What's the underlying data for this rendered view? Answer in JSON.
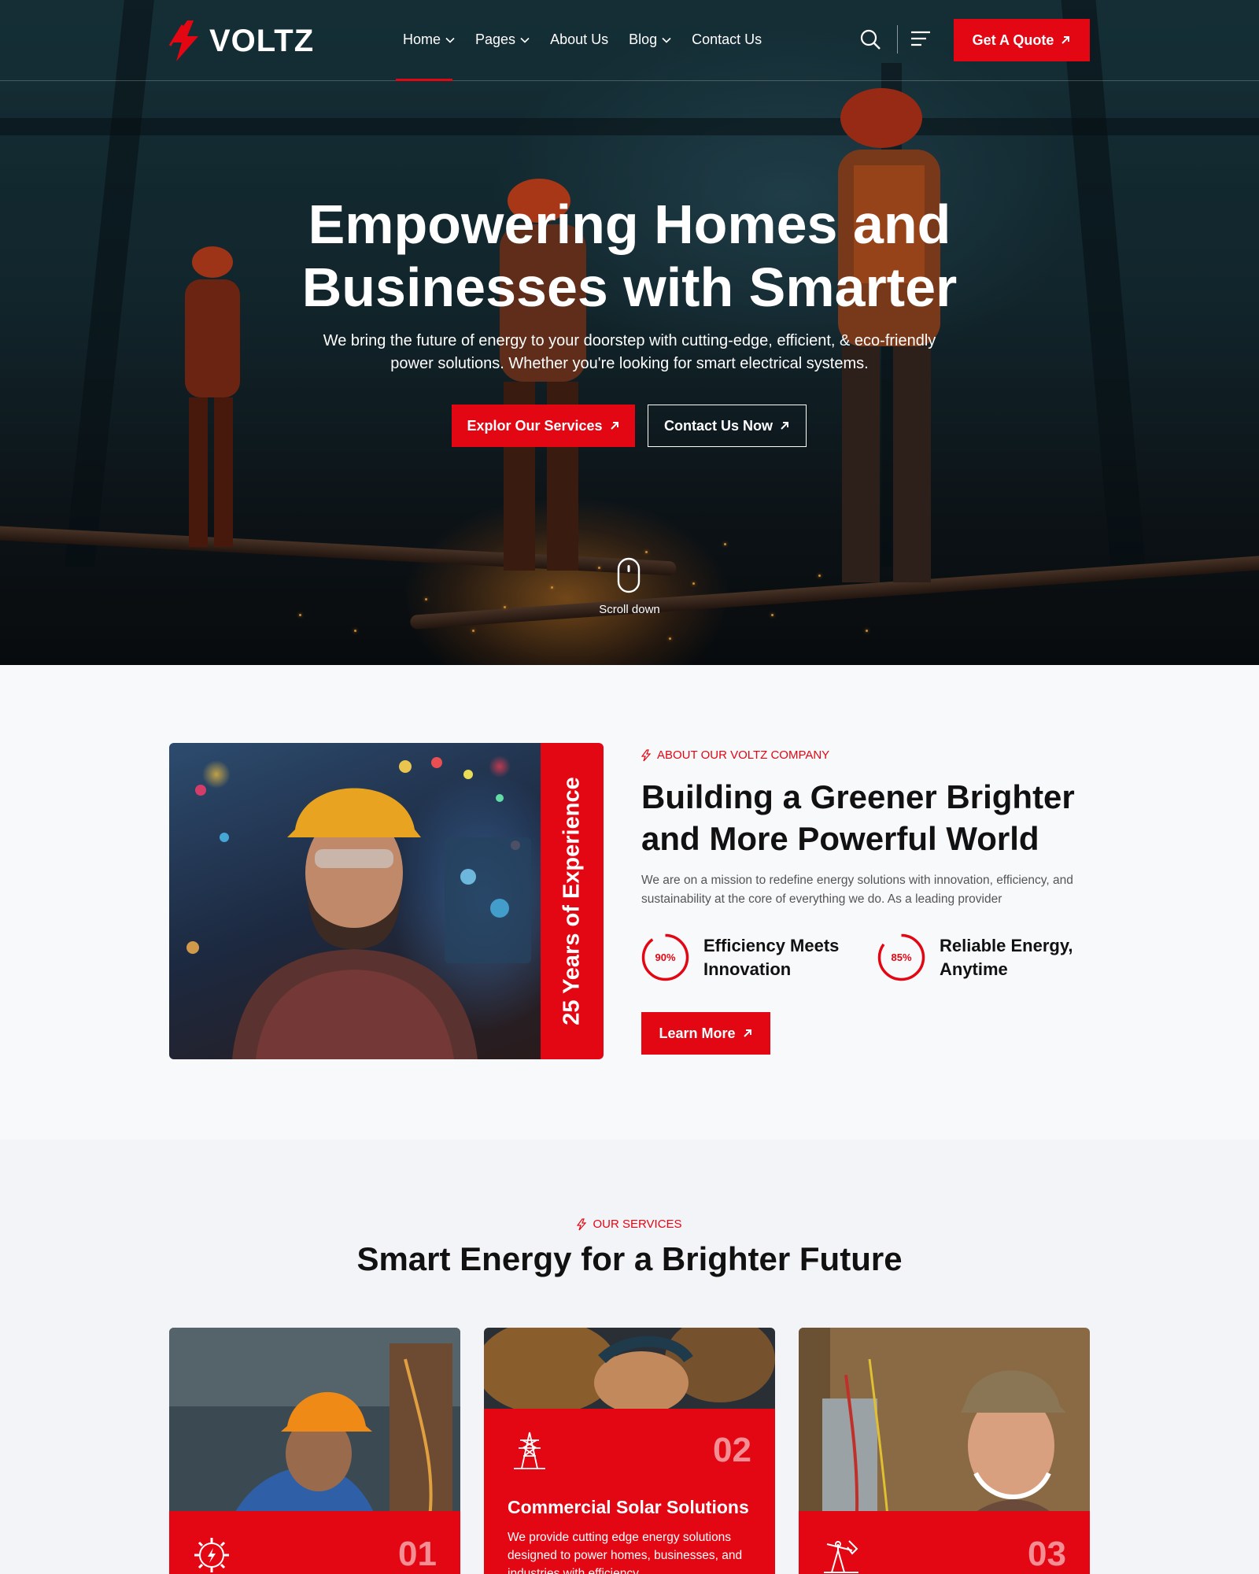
{
  "nav": {
    "logo": "VOLTZ",
    "items": [
      {
        "label": "Home",
        "dropdown": true,
        "active": true
      },
      {
        "label": "Pages",
        "dropdown": true
      },
      {
        "label": "About Us",
        "dropdown": false
      },
      {
        "label": "Blog",
        "dropdown": true
      },
      {
        "label": "Contact Us",
        "dropdown": false
      }
    ],
    "quote_label": "Get A Quote"
  },
  "hero": {
    "title": "Empowering Homes and Businesses with Smarter",
    "subtitle": "We bring the future of energy to your doorstep with cutting-edge, efficient, & eco-friendly power solutions. Whether you're looking for smart electrical systems.",
    "primary_cta": "Explor Our Services",
    "secondary_cta": "Contact Us Now",
    "scroll_label": "Scroll down"
  },
  "about": {
    "experience_band": "25 Years of Experience",
    "eyebrow": "ABOUT OUR VOLTZ COMPANY",
    "title": "Building a Greener Brighter and More Powerful World",
    "description": "We are on a mission to redefine energy solutions with innovation, efficiency, and sustainability at the core of everything we do. As a leading provider",
    "stats": [
      {
        "percent": 90,
        "value_label": "90%",
        "label": "Efficiency Meets Innovation"
      },
      {
        "percent": 85,
        "value_label": "85%",
        "label": "Reliable Energy, Anytime"
      }
    ],
    "cta": "Learn More"
  },
  "services": {
    "eyebrow": "OUR SERVICES",
    "title": "Smart Energy for a Brighter Future",
    "cards": [
      {
        "number": "01",
        "icon": "gear-bolt-icon"
      },
      {
        "number": "02",
        "icon": "transmission-tower-icon",
        "title": "Commercial Solar Solutions",
        "text": "We provide cutting edge energy solutions designed to power homes, businesses, and industries with efficiency."
      },
      {
        "number": "03",
        "icon": "oil-pump-icon"
      }
    ]
  },
  "colors": {
    "accent": "#e30613",
    "dark": "#111111",
    "muted_text": "#555555"
  }
}
